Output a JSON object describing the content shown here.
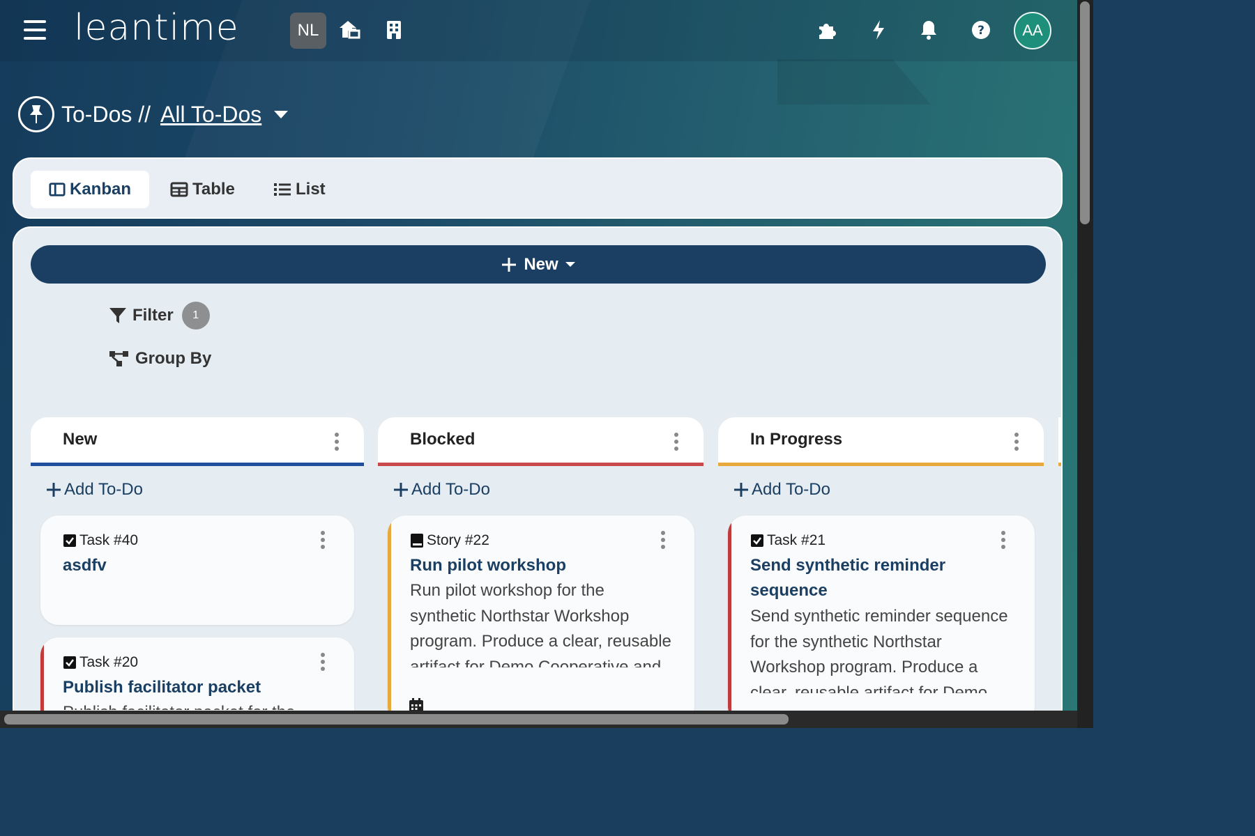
{
  "header": {
    "logo": "leantime",
    "workspace_badge": "NL",
    "avatar_initials": "AA",
    "icons": [
      "menu-icon",
      "home-projects-icon",
      "company-icon",
      "puzzle-icon",
      "bolt-icon",
      "bell-icon",
      "help-icon"
    ]
  },
  "page": {
    "title": "To-Dos //",
    "view_link": "All To-Dos"
  },
  "tabs": [
    {
      "label": "Kanban",
      "active": true
    },
    {
      "label": "Table",
      "active": false
    },
    {
      "label": "List",
      "active": false
    }
  ],
  "toolbar": {
    "new_label": "New",
    "filter_label": "Filter",
    "filter_count": "1",
    "groupby_label": "Group By"
  },
  "columns": [
    {
      "title": "New",
      "color": "#1f4e9c",
      "add_label": "Add To-Do",
      "cards": [
        {
          "type": "Task #40",
          "title": "asdfv",
          "desc": "",
          "accent": ""
        },
        {
          "type": "Task #20",
          "title": "Publish facilitator packet",
          "desc": "Publish facilitator packet for the",
          "accent": "#c23b3b"
        }
      ]
    },
    {
      "title": "Blocked",
      "color": "#c9494b",
      "add_label": "Add To-Do",
      "cards": [
        {
          "type": "Story #22",
          "title": "Run pilot workshop",
          "desc": "Run pilot workshop for the synthetic Northstar Workshop program. Produce a clear, reusable artifact for Demo Cooperative and",
          "accent": "#e8a93c"
        }
      ]
    },
    {
      "title": "In Progress",
      "color": "#e8a93c",
      "add_label": "Add To-Do",
      "cards": [
        {
          "type": "Task #21",
          "title": "Send synthetic reminder sequence",
          "desc": "Send synthetic reminder sequence for the synthetic Northstar Workshop program. Produce a clear, reusable artifact for Demo",
          "accent": "#c23b3b"
        }
      ]
    }
  ]
}
